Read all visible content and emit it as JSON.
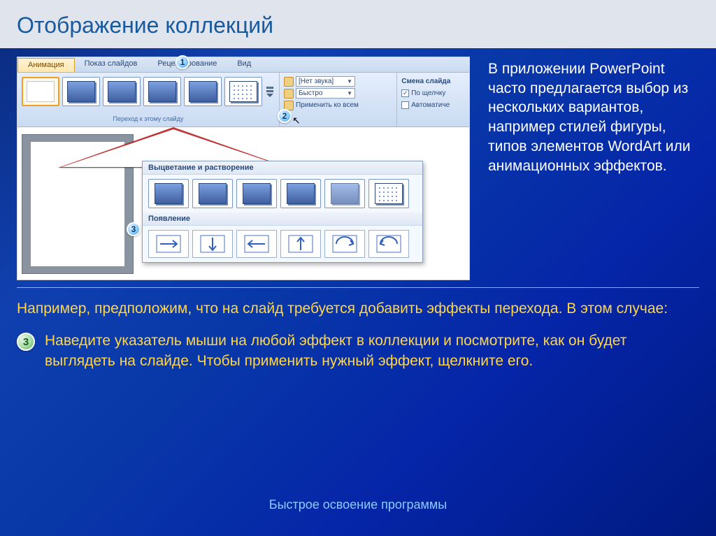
{
  "title": "Отображение коллекций",
  "body_text": "В приложении PowerPoint часто предлагается выбор из нескольких вариантов, например стилей фигуры, типов элементов WordArt или анимационных эффектов.",
  "lead_text": "Например, предположим, что на слайд требуется добавить эффекты перехода. В этом случае:",
  "step": {
    "num": "3",
    "text": "Наведите указатель мыши на любой эффект в коллекции и посмотрите, как он будет выглядеть на слайде. Чтобы применить нужный эффект, щелкните его."
  },
  "footer": "Быстрое освоение программы",
  "ribbon": {
    "tabs": [
      "Анимация",
      "Показ слайдов",
      "Рецензирование",
      "Вид"
    ],
    "callouts": [
      "1",
      "2",
      "3"
    ],
    "sound_group": {
      "sound": "[Нет звука]",
      "speed": "Быстро",
      "apply_all": "Применить ко всем"
    },
    "advance_group": {
      "title": "Смена слайда",
      "on_click": "По щелчку",
      "auto": "Автоматиче"
    },
    "transition_label": "Переход к этому слайду"
  },
  "popup": {
    "section1": "Выцветание и растворение",
    "section2": "Появление"
  }
}
